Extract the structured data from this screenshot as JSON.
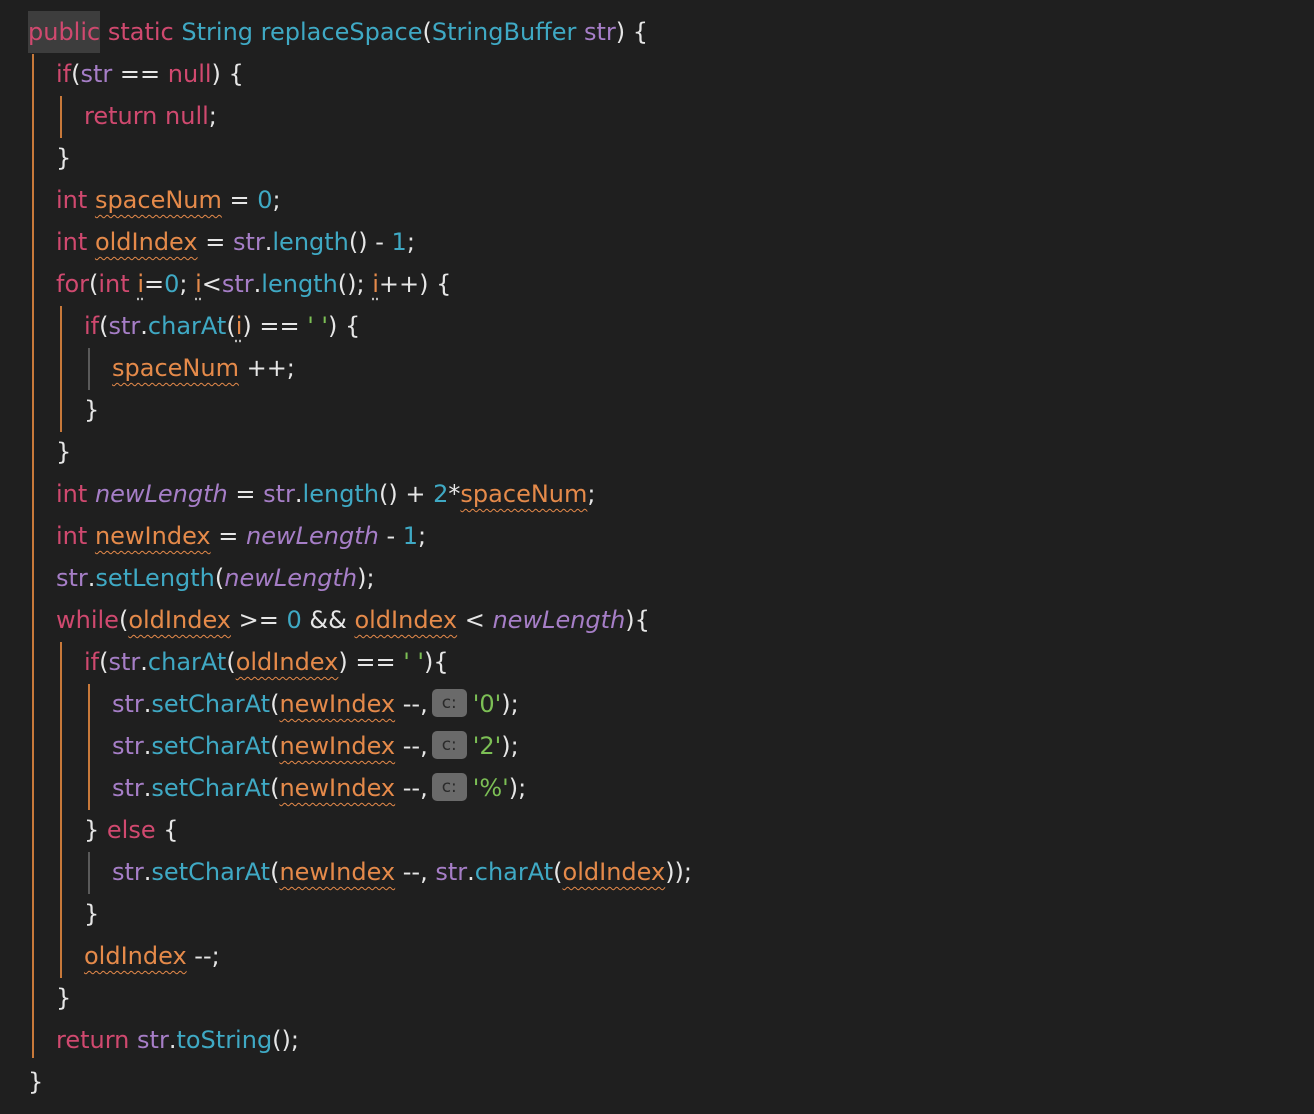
{
  "editor": {
    "language": "Java",
    "theme_colors": {
      "background": "#1f1f1f",
      "keyword": "#d0496f",
      "type": "#3fa9c4",
      "field": "#a67ec7",
      "local": "#e58a4a",
      "string": "#7cbf55",
      "hint_bg": "#6a6a6a"
    },
    "lines": [
      [
        {
          "t": "public",
          "c": "kw sel-public"
        },
        {
          "t": " "
        },
        {
          "t": "static",
          "c": "kw"
        },
        {
          "t": " "
        },
        {
          "t": "String",
          "c": "ty"
        },
        {
          "t": " "
        },
        {
          "t": "replaceSpace",
          "c": "fn"
        },
        {
          "t": "("
        },
        {
          "t": "StringBuffer",
          "c": "ty"
        },
        {
          "t": " "
        },
        {
          "t": "str",
          "c": "var"
        },
        {
          "t": ") {"
        }
      ],
      [
        {
          "t": "if",
          "c": "kw"
        },
        {
          "t": "("
        },
        {
          "t": "str",
          "c": "var"
        },
        {
          "t": " == "
        },
        {
          "t": "null",
          "c": "kw"
        },
        {
          "t": ") {"
        }
      ],
      [
        {
          "t": "return",
          "c": "kw"
        },
        {
          "t": " "
        },
        {
          "t": "null",
          "c": "kw"
        },
        {
          "t": ";"
        }
      ],
      [
        {
          "t": "}"
        }
      ],
      [
        {
          "t": "int",
          "c": "kw"
        },
        {
          "t": " "
        },
        {
          "t": "spaceNum",
          "c": "loc squig"
        },
        {
          "t": " = "
        },
        {
          "t": "0",
          "c": "num"
        },
        {
          "t": ";"
        }
      ],
      [
        {
          "t": "int",
          "c": "kw"
        },
        {
          "t": " "
        },
        {
          "t": "oldIndex",
          "c": "loc squig"
        },
        {
          "t": " = "
        },
        {
          "t": "str",
          "c": "var"
        },
        {
          "t": "."
        },
        {
          "t": "length",
          "c": "fn"
        },
        {
          "t": "() - "
        },
        {
          "t": "1",
          "c": "num"
        },
        {
          "t": ";"
        }
      ],
      [
        {
          "t": "for",
          "c": "kw"
        },
        {
          "t": "("
        },
        {
          "t": "int",
          "c": "kw"
        },
        {
          "t": " "
        },
        {
          "t": "i",
          "c": "loc caret-hint"
        },
        {
          "t": "="
        },
        {
          "t": "0",
          "c": "num"
        },
        {
          "t": "; "
        },
        {
          "t": "i",
          "c": "loc caret-hint"
        },
        {
          "t": "<"
        },
        {
          "t": "str",
          "c": "var"
        },
        {
          "t": "."
        },
        {
          "t": "length",
          "c": "fn"
        },
        {
          "t": "(); "
        },
        {
          "t": "i",
          "c": "loc caret-hint"
        },
        {
          "t": "++) {"
        }
      ],
      [
        {
          "t": "if",
          "c": "kw"
        },
        {
          "t": "("
        },
        {
          "t": "str",
          "c": "var"
        },
        {
          "t": "."
        },
        {
          "t": "charAt",
          "c": "fn"
        },
        {
          "t": "("
        },
        {
          "t": "i",
          "c": "loc caret-hint"
        },
        {
          "t": ") == "
        },
        {
          "t": "' '",
          "c": "str"
        },
        {
          "t": ") {"
        }
      ],
      [
        {
          "t": "spaceNum",
          "c": "loc squig"
        },
        {
          "t": " ++;"
        }
      ],
      [
        {
          "t": "}"
        }
      ],
      [
        {
          "t": "}"
        }
      ],
      [
        {
          "t": "int",
          "c": "kw"
        },
        {
          "t": " "
        },
        {
          "t": "newLength",
          "c": "var it"
        },
        {
          "t": " = "
        },
        {
          "t": "str",
          "c": "var"
        },
        {
          "t": "."
        },
        {
          "t": "length",
          "c": "fn"
        },
        {
          "t": "() + "
        },
        {
          "t": "2",
          "c": "num"
        },
        {
          "t": "*"
        },
        {
          "t": "spaceNum",
          "c": "loc squig"
        },
        {
          "t": ";"
        }
      ],
      [
        {
          "t": "int",
          "c": "kw"
        },
        {
          "t": " "
        },
        {
          "t": "newIndex",
          "c": "loc squig"
        },
        {
          "t": " = "
        },
        {
          "t": "newLength",
          "c": "var it"
        },
        {
          "t": " - "
        },
        {
          "t": "1",
          "c": "num"
        },
        {
          "t": ";"
        }
      ],
      [
        {
          "t": "str",
          "c": "var"
        },
        {
          "t": "."
        },
        {
          "t": "setLength",
          "c": "fn"
        },
        {
          "t": "("
        },
        {
          "t": "newLength",
          "c": "var it"
        },
        {
          "t": ");"
        }
      ],
      [
        {
          "t": "while",
          "c": "kw"
        },
        {
          "t": "("
        },
        {
          "t": "oldIndex",
          "c": "loc squig"
        },
        {
          "t": " >= "
        },
        {
          "t": "0",
          "c": "num"
        },
        {
          "t": " && "
        },
        {
          "t": "oldIndex",
          "c": "loc squig"
        },
        {
          "t": " < "
        },
        {
          "t": "newLength",
          "c": "var it"
        },
        {
          "t": "){"
        }
      ],
      [
        {
          "t": "if",
          "c": "kw"
        },
        {
          "t": "("
        },
        {
          "t": "str",
          "c": "var"
        },
        {
          "t": "."
        },
        {
          "t": "charAt",
          "c": "fn"
        },
        {
          "t": "("
        },
        {
          "t": "oldIndex",
          "c": "loc squig"
        },
        {
          "t": ") == "
        },
        {
          "t": "' '",
          "c": "str"
        },
        {
          "t": "){"
        }
      ],
      [
        {
          "t": "str",
          "c": "var"
        },
        {
          "t": "."
        },
        {
          "t": "setCharAt",
          "c": "fn"
        },
        {
          "t": "("
        },
        {
          "t": "newIndex",
          "c": "loc squig"
        },
        {
          "t": " --,"
        },
        {
          "t": "c:",
          "c": "hint"
        },
        {
          "t": "'0'",
          "c": "str"
        },
        {
          "t": ");"
        }
      ],
      [
        {
          "t": "str",
          "c": "var"
        },
        {
          "t": "."
        },
        {
          "t": "setCharAt",
          "c": "fn"
        },
        {
          "t": "("
        },
        {
          "t": "newIndex",
          "c": "loc squig"
        },
        {
          "t": " --,"
        },
        {
          "t": "c:",
          "c": "hint"
        },
        {
          "t": "'2'",
          "c": "str"
        },
        {
          "t": ");"
        }
      ],
      [
        {
          "t": "str",
          "c": "var"
        },
        {
          "t": "."
        },
        {
          "t": "setCharAt",
          "c": "fn"
        },
        {
          "t": "("
        },
        {
          "t": "newIndex",
          "c": "loc squig"
        },
        {
          "t": " --,"
        },
        {
          "t": "c:",
          "c": "hint"
        },
        {
          "t": "'%'",
          "c": "str"
        },
        {
          "t": ");"
        }
      ],
      [
        {
          "t": "} "
        },
        {
          "t": "else",
          "c": "kw"
        },
        {
          "t": " {"
        }
      ],
      [
        {
          "t": "str",
          "c": "var"
        },
        {
          "t": "."
        },
        {
          "t": "setCharAt",
          "c": "fn"
        },
        {
          "t": "("
        },
        {
          "t": "newIndex",
          "c": "loc squig"
        },
        {
          "t": " --, "
        },
        {
          "t": "str",
          "c": "var"
        },
        {
          "t": "."
        },
        {
          "t": "charAt",
          "c": "fn"
        },
        {
          "t": "("
        },
        {
          "t": "oldIndex",
          "c": "loc squig"
        },
        {
          "t": "));"
        }
      ],
      [
        {
          "t": "}"
        }
      ],
      [
        {
          "t": "oldIndex",
          "c": "loc squig"
        },
        {
          "t": " --;"
        }
      ],
      [
        {
          "t": "}"
        }
      ],
      [
        {
          "t": "return",
          "c": "kw"
        },
        {
          "t": " "
        },
        {
          "t": "str",
          "c": "var"
        },
        {
          "t": "."
        },
        {
          "t": "toString",
          "c": "fn"
        },
        {
          "t": "();"
        }
      ],
      [
        {
          "t": "}"
        }
      ]
    ]
  }
}
